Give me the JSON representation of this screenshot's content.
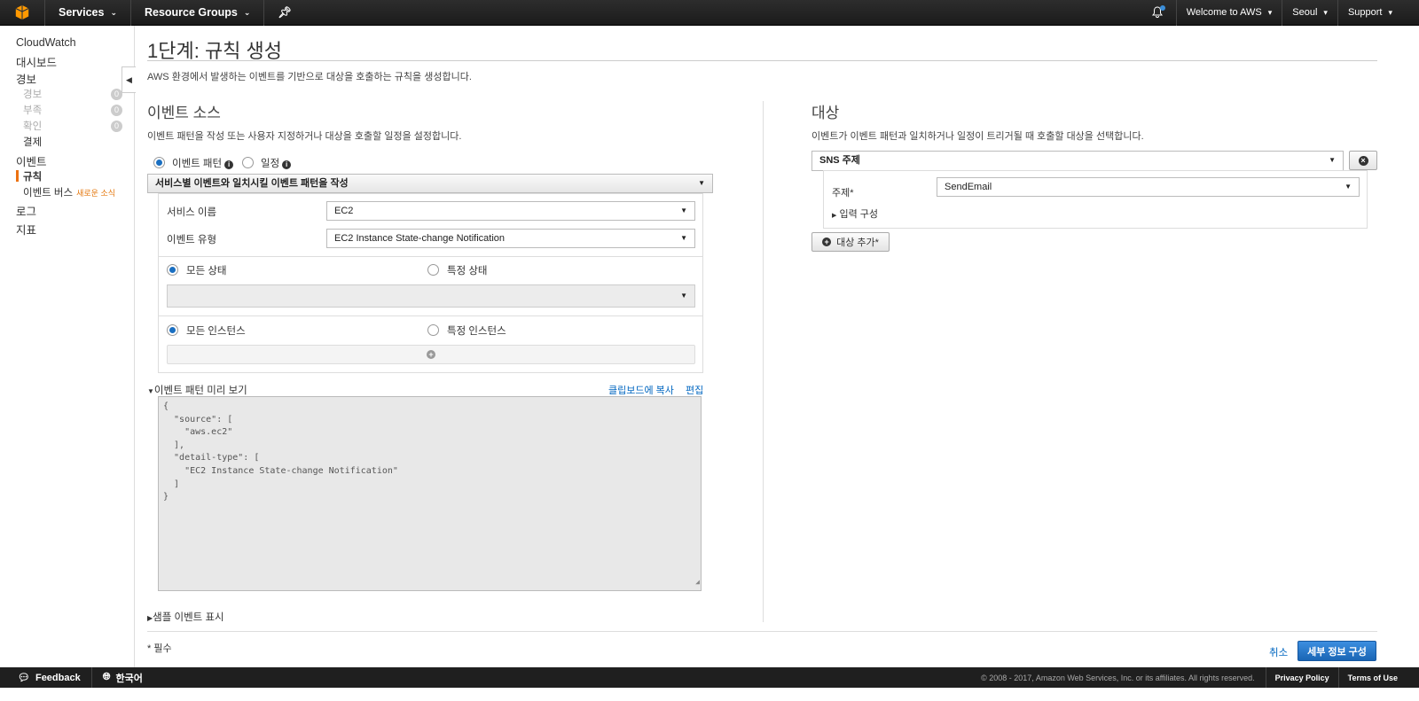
{
  "topbar": {
    "services": "Services",
    "resource_groups": "Resource Groups",
    "account": "Welcome to AWS",
    "region": "Seoul",
    "support": "Support"
  },
  "sidebar": {
    "cloudwatch": "CloudWatch",
    "dashboards": "대시보드",
    "alarms": "경보",
    "alarm_states": [
      {
        "label": "경보",
        "count": "0"
      },
      {
        "label": "부족",
        "count": "0"
      },
      {
        "label": "확인",
        "count": "0"
      }
    ],
    "billing": "결제",
    "events": "이벤트",
    "rules": "규칙",
    "event_buses": "이벤트 버스",
    "event_buses_new": "새로운 소식",
    "logs": "로그",
    "metrics": "지표"
  },
  "page": {
    "title": "1단계: 규칙 생성",
    "description": "AWS 환경에서 발생하는 이벤트를 기반으로 대상을 호출하는 규칙을 생성합니다."
  },
  "event_source": {
    "title": "이벤트 소스",
    "description": "이벤트 패턴을 작성 또는 사용자 지정하거나 대상을 호출할 일정을 설정합니다.",
    "radio_pattern": "이벤트 패턴",
    "radio_schedule": "일정",
    "pattern_mode": "서비스별 이벤트와 일치시킬 이벤트 패턴을 작성",
    "service_label": "서비스 이름",
    "service_value": "EC2",
    "event_type_label": "이벤트 유형",
    "event_type_value": "EC2 Instance State-change Notification",
    "any_state": "모든 상태",
    "specific_state": "특정 상태",
    "any_instance": "모든 인스턴스",
    "specific_instance": "특정 인스턴스",
    "preview_label": "이벤트 패턴 미리 보기",
    "copy_clipboard": "클립보드에 복사",
    "edit": "편집",
    "pattern_json": "{\n  \"source\": [\n    \"aws.ec2\"\n  ],\n  \"detail-type\": [\n    \"EC2 Instance State-change Notification\"\n  ]\n}",
    "show_sample": "샘플 이벤트 표시"
  },
  "targets": {
    "title": "대상",
    "description": "이벤트가 이벤트 패턴과 일치하거나 일정이 트리거될 때 호출할 대상을 선택합니다.",
    "target_type": "SNS 주제",
    "topic_label": "주제*",
    "topic_value": "SendEmail",
    "configure_input": "입력 구성",
    "add_target": "대상 추가*"
  },
  "footer": {
    "required": "* 필수",
    "cancel": "취소",
    "configure_details": "세부 정보 구성"
  },
  "bottombar": {
    "feedback": "Feedback",
    "language": "한국어",
    "copyright": "© 2008 - 2017, Amazon Web Services, Inc. or its affiliates. All rights reserved.",
    "privacy": "Privacy Policy",
    "terms": "Terms of Use"
  }
}
